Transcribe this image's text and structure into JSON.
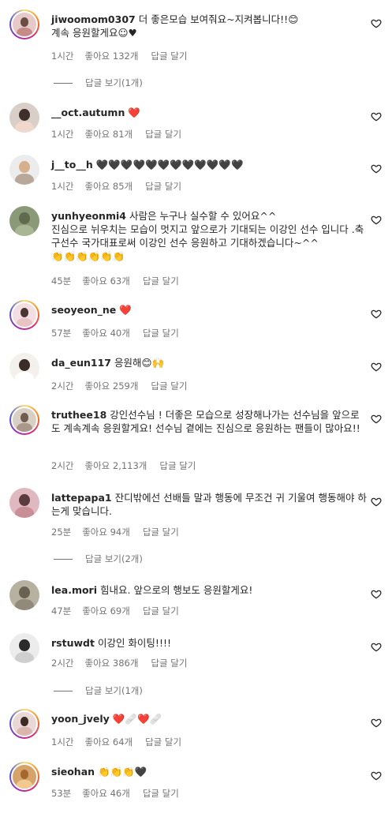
{
  "comments": [
    {
      "username": "jiwoomom0307",
      "text": "더 좋은모습 보여줘요~지켜봅니다!!",
      "emoji": "😊",
      "text2": "계속 응원할게요☺♥",
      "time": "1시간",
      "likes": "좋아요 132개",
      "reply": "답글 달기",
      "view_replies": "답글 보기(1개)",
      "avatar_colors": [
        "#e8c9c9",
        "#6a4e42",
        "#c48b87"
      ]
    },
    {
      "username": "__oct.autumn",
      "text": "",
      "emoji": "❤️",
      "time": "1시간",
      "likes": "좋아요 81개",
      "reply": "답글 달기",
      "avatar_colors": [
        "#d9cfc8",
        "#3e2f2a",
        "#f0d9cc"
      ]
    },
    {
      "username": "j__to__h",
      "text": "",
      "emoji": "🖤🖤🖤🖤🖤🖤🖤🖤🖤🖤🖤🖤",
      "time": "1시간",
      "likes": "좋아요 85개",
      "reply": "답글 달기",
      "avatar_colors": [
        "#ececec",
        "#d6b08c",
        "#b7a89a"
      ]
    },
    {
      "username": "yunhyeonmi4",
      "text": "사람은 누구나 실수할 수 있어요^^\n진심으로 뉘우치는 모습이 멋지고 앞으로가 기대되는 이강인 선수 입니다 .축구선수 국가대표로써 이강인 선수 응원하고 기대하겠습니다~^^",
      "emoji": "👏👏👏👏👏👏",
      "time": "45분",
      "likes": "좋아요 63개",
      "reply": "답글 달기",
      "avatar_colors": [
        "#8a9a78",
        "#5e6b4f",
        "#a9b693"
      ]
    },
    {
      "username": "seoyeon_ne",
      "text": "",
      "emoji": "❤️",
      "time": "57분",
      "likes": "좋아요 40개",
      "reply": "답글 달기",
      "avatar_colors": [
        "#f3dfe3",
        "#4b3530",
        "#e8c4c2"
      ]
    },
    {
      "username": "da_eun117",
      "text": "응원해",
      "emoji": "😊🙌",
      "time": "2시간",
      "likes": "좋아요 259개",
      "reply": "답글 달기",
      "avatar_colors": [
        "#f4f1ec",
        "#3a2d27",
        "#ffffff"
      ]
    },
    {
      "username": "truthee18",
      "text": "강인선수님 ! 더좋은 모습으로 성장해나가는 선수님을 앞으로도 계속계속 응원할게요! 선수님 곁에는 진심으로 응원하는 팬들이 많아요!!",
      "emoji": "",
      "time": "2시간",
      "likes": "좋아요 2,113개",
      "reply": "답글 달기",
      "avatar_colors": [
        "#d8d0c4",
        "#6f5d50",
        "#a8978a"
      ]
    },
    {
      "username": "lattepapa1",
      "text": "잔디밖에선 선배들 말과 행동에 무조건 귀 기울여 행동해야 하는게 맞습니다.",
      "emoji": "",
      "time": "25분",
      "likes": "좋아요 94개",
      "reply": "답글 달기",
      "view_replies": "답글 보기(2개)",
      "avatar_colors": [
        "#e0b8c0",
        "#5b3b3b",
        "#c98f96"
      ]
    },
    {
      "username": "lea.mori",
      "text": "힘내요. 앞으로의 행보도 응원할게요!",
      "emoji": "",
      "time": "47분",
      "likes": "좋아요 69개",
      "reply": "답글 달기",
      "avatar_colors": [
        "#b7b1a2",
        "#6a6152",
        "#918a7a"
      ]
    },
    {
      "username": "rstuwdt",
      "text": "이강인 화이팅!!!!",
      "emoji": "",
      "time": "2시간",
      "likes": "좋아요 386개",
      "reply": "답글 달기",
      "view_replies": "답글 보기(1개)",
      "avatar_colors": [
        "#ececec",
        "#2c2a2a",
        "#cfcfcf"
      ]
    },
    {
      "username": "yoon_jvely",
      "text": "",
      "emoji": "❤️🩹❤️🩹",
      "time": "1시간",
      "likes": "좋아요 64개",
      "reply": "답글 달기",
      "avatar_colors": [
        "#ead8d6",
        "#3b2a26",
        "#d9b7ae"
      ]
    },
    {
      "username": "sieohan",
      "text": "",
      "emoji": "👏👏👏🖤",
      "time": "53분",
      "likes": "좋아요 46개",
      "reply": "답글 달기",
      "avatar_colors": [
        "#d6a46a",
        "#a4682e",
        "#f0c890"
      ]
    }
  ],
  "icons": {
    "like_button": "heart-outline-icon"
  }
}
